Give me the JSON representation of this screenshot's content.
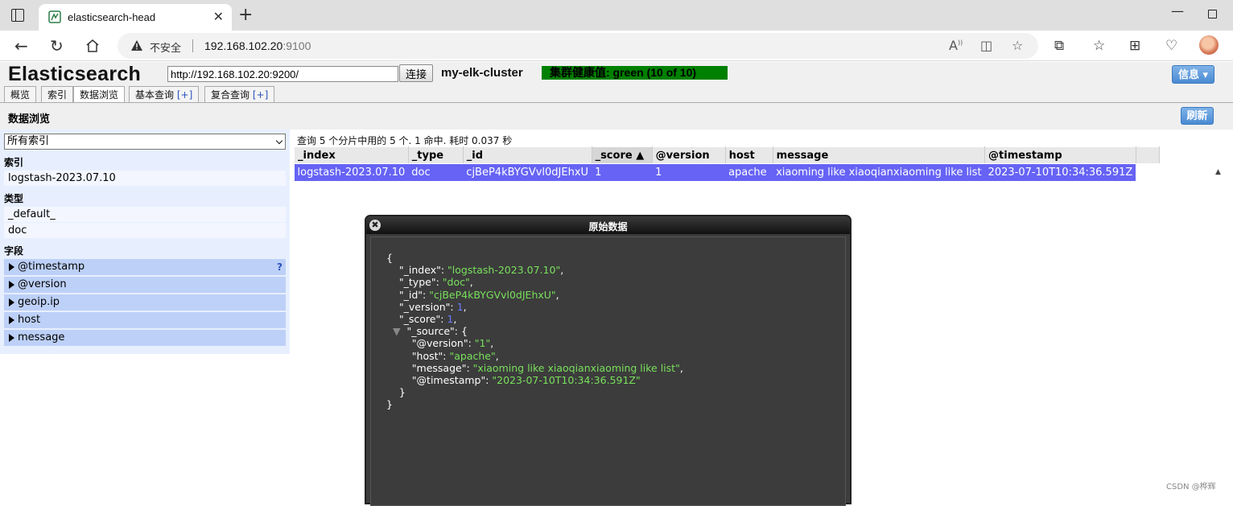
{
  "browser": {
    "tab_title": "elasticsearch-head",
    "security_label": "不安全",
    "url_host": "192.168.102.20",
    "url_port": ":9100"
  },
  "header": {
    "title": "Elasticsearch",
    "connect_url": "http://192.168.102.20:9200/",
    "connect_label": "连接",
    "cluster_name": "my-elk-cluster",
    "cluster_health": "集群健康值: green (10 of 10)",
    "info_label": "信息 ▾"
  },
  "tabs": [
    {
      "label": "概览"
    },
    {
      "label": "索引"
    },
    {
      "label": "数据浏览"
    },
    {
      "label": "基本查询",
      "plus": "[+]"
    },
    {
      "label": "复合查询",
      "plus": "[+]"
    }
  ],
  "section": {
    "title": "数据浏览",
    "refresh_label": "刷新"
  },
  "sidebar": {
    "select_value": "所有索引",
    "index_heading": "索引",
    "indices": [
      "logstash-2023.07.10"
    ],
    "type_heading": "类型",
    "types": [
      "_default_",
      "doc"
    ],
    "field_heading": "字段",
    "fields": [
      "@timestamp",
      "@version",
      "geoip.ip",
      "host",
      "message"
    ],
    "help_mark": "?"
  },
  "results": {
    "summary": "查询 5 个分片中用的 5 个. 1 命中. 耗时 0.037 秒",
    "columns": [
      "_index",
      "_type",
      "_id",
      "_score ▲",
      "@version",
      "host",
      "message",
      "@timestamp"
    ],
    "rows": [
      [
        "logstash-2023.07.10",
        "doc",
        "cjBeP4kBYGVvl0dJEhxU",
        "1",
        "1",
        "apache",
        "xiaoming like xiaoqianxiaoming like list",
        "2023-07-10T10:34:36.591Z"
      ]
    ]
  },
  "dialog": {
    "title": "原始数据",
    "close_glyph": "✖",
    "doc": {
      "_index": "logstash-2023.07.10",
      "_type": "doc",
      "_id": "cjBeP4kBYGVvl0dJEhxU",
      "_version": "1",
      "_score": "1",
      "source_version": "1",
      "source_host": "apache",
      "source_message": "xiaoming like xiaoqianxiaoming like list",
      "source_timestamp": "2023-07-10T10:34:36.591Z"
    }
  },
  "watermark": "CSDN @桦辉",
  "colors": {
    "health_green": "#008000",
    "selected_row": "#6663f5",
    "json_string": "#79e05c",
    "json_number": "#6a7cff",
    "sidebar_bg": "#e7efff",
    "field_bg": "#bdd0f7",
    "button_blue": "#4a8ad3"
  },
  "icons": [
    "window-icon",
    "tab-favicon-icon",
    "close-tab-icon",
    "new-tab-icon",
    "minimize-icon",
    "maximize-icon",
    "back-icon",
    "reload-icon",
    "home-icon",
    "warning-icon",
    "read-aloud-icon",
    "split-screen-icon",
    "favorite-star-icon",
    "extensions-icon",
    "favorites-icon",
    "collections-icon",
    "health-icon",
    "profile-avatar"
  ]
}
